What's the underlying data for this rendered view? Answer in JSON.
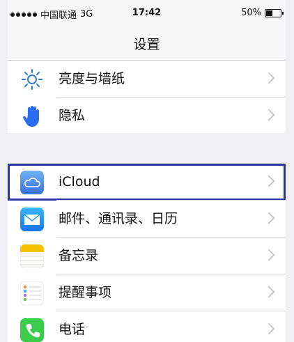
{
  "status_bar": {
    "carrier": "中国联通",
    "network": "3G",
    "time": "17:42",
    "battery_percent": "50%",
    "battery_level": 0.5
  },
  "navbar": {
    "title": "设置"
  },
  "group1": [
    {
      "label": "亮度与墙纸",
      "icon": "brightness-icon"
    },
    {
      "label": "隐私",
      "icon": "privacy-hand-icon"
    }
  ],
  "group2": [
    {
      "label": "iCloud",
      "icon": "icloud-icon",
      "highlighted": true
    },
    {
      "label": "邮件、通讯录、日历",
      "icon": "mail-icon"
    },
    {
      "label": "备忘录",
      "icon": "notes-icon"
    },
    {
      "label": "提醒事项",
      "icon": "reminders-icon"
    },
    {
      "label": "电话",
      "icon": "phone-icon"
    }
  ],
  "colors": {
    "highlight_border": "#2b35a8",
    "icloud": "#4a8ef0",
    "mail": "#1a8cf0",
    "notes": "#f7c300",
    "phone": "#3ccc4b",
    "privacy": "#2a6df1"
  }
}
